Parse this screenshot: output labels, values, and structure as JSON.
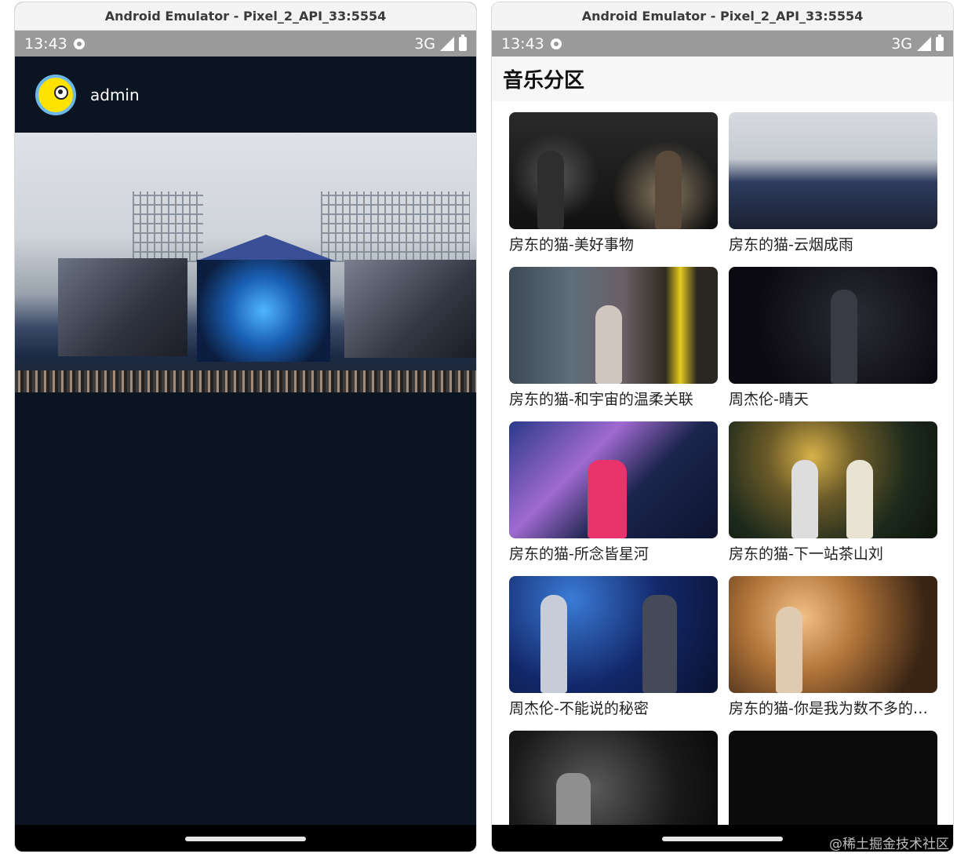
{
  "left_window": {
    "title": "Android Emulator - Pixel_2_API_33:5554",
    "status": {
      "time": "13:43",
      "network": "3G"
    },
    "user": {
      "name": "admin"
    },
    "banner": {
      "description": "concert stage banner"
    }
  },
  "right_window": {
    "title": "Android Emulator - Pixel_2_API_33:5554",
    "status": {
      "time": "13:43",
      "network": "3G"
    },
    "header": "音乐分区",
    "videos": [
      {
        "caption": "房东的猫-美好事物"
      },
      {
        "caption": "房东的猫-云烟成雨"
      },
      {
        "caption": "房东的猫-和宇宙的温柔关联"
      },
      {
        "caption": "周杰伦-晴天"
      },
      {
        "caption": "房东的猫-所念皆星河"
      },
      {
        "caption": "房东的猫-下一站茶山刘"
      },
      {
        "caption": "周杰伦-不能说的秘密"
      },
      {
        "caption": "房东的猫-你是我为数不多的骄傲"
      },
      {
        "caption": ""
      },
      {
        "caption": ""
      }
    ]
  },
  "watermark": "@稀土掘金技术社区",
  "colors": {
    "dark_bg": "#0b1522",
    "status_bar": "#9a9a9a",
    "avatar_yellow": "#ffe300"
  }
}
